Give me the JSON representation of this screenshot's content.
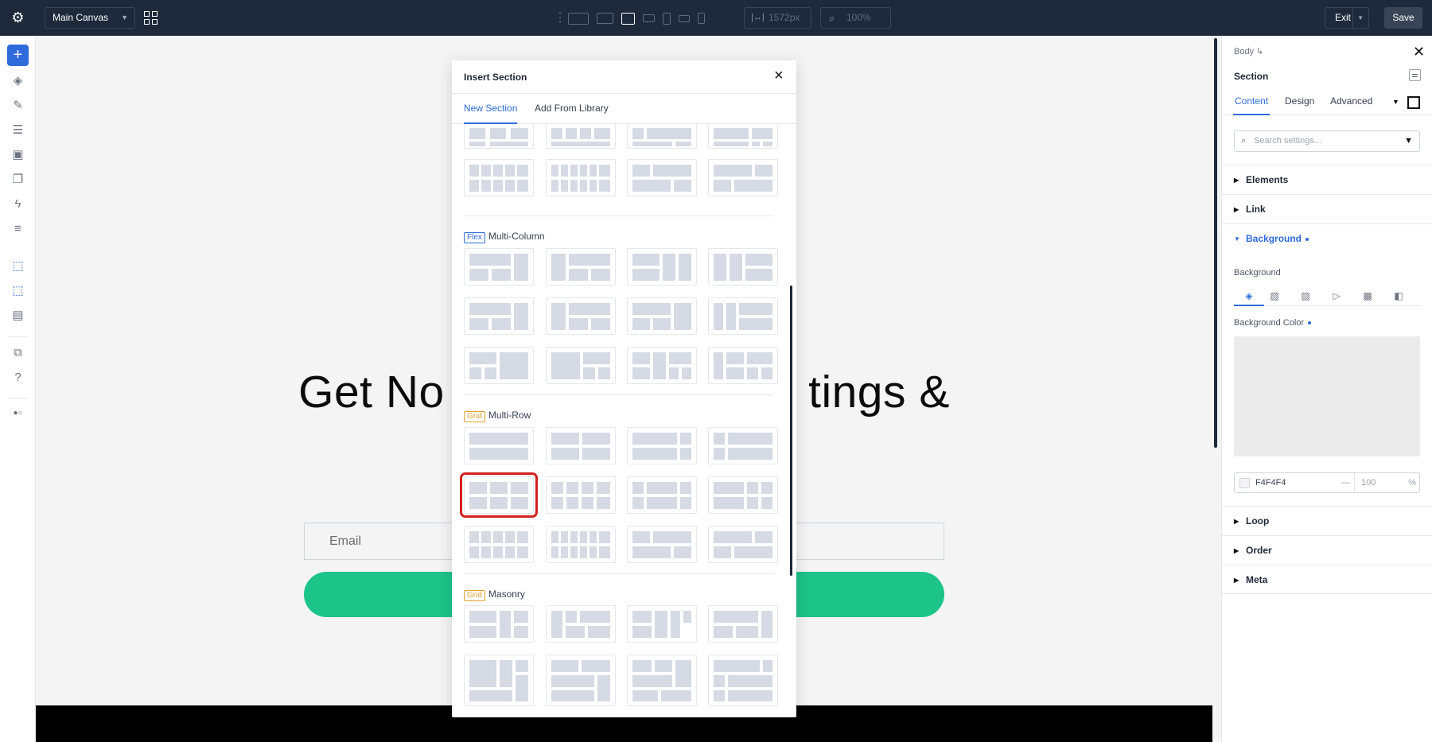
{
  "topbar": {
    "canvas_select": "Main Canvas",
    "width_value": "1572px",
    "zoom_value": "100%",
    "exit_label": "Exit",
    "save_label": "Save"
  },
  "canvas": {
    "hero_title": "Get No                            tings &",
    "email_placeholder": "Email"
  },
  "modal": {
    "title": "Insert Section",
    "close": "×",
    "tabs": [
      "New Section",
      "Add From Library"
    ],
    "categories": [
      {
        "badge": "Flex",
        "label": "Multi-Column"
      },
      {
        "badge": "Grid",
        "label": "Multi-Row"
      },
      {
        "badge": "Grid",
        "label": "Masonry"
      }
    ]
  },
  "panel": {
    "breadcrumb": "Body",
    "section_title": "Section",
    "tabs": [
      "Content",
      "Design",
      "Advanced"
    ],
    "search_placeholder": "Search settings...",
    "groups": {
      "elements": "Elements",
      "link": "Link",
      "background": "Background",
      "loop": "Loop",
      "order": "Order",
      "meta": "Meta"
    },
    "background_label": "Background",
    "background_color_label": "Background Color",
    "color_hex": "F4F4F4",
    "color_dash": "—",
    "opacity": "100",
    "opacity_unit": "%"
  },
  "colors": {
    "accent": "#2f6bdb",
    "topbar": "#1e2a3b",
    "cta": "#1dc48a",
    "selected_outline": "#d32020"
  }
}
